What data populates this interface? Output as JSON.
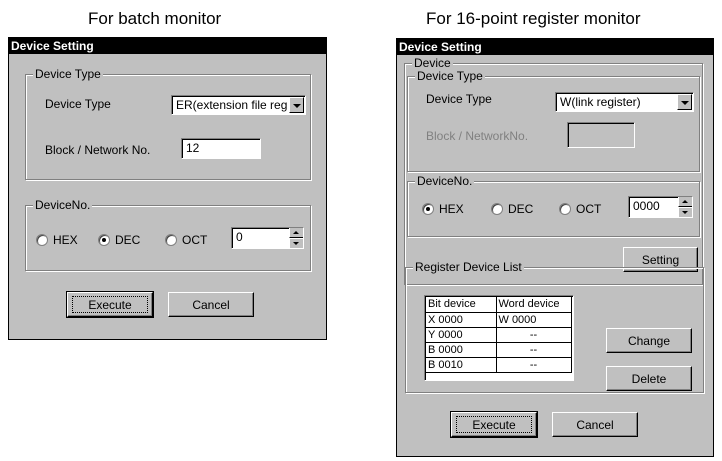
{
  "captions": {
    "batch": "For batch monitor",
    "register": "For 16-point register monitor"
  },
  "batch_dialog": {
    "title": "Device Setting",
    "device_type_group": "Device Type",
    "device_type_label": "Device Type",
    "device_type_value": "ER(extension file regi",
    "block_label": "Block / Network No.",
    "block_value": "12",
    "device_no_group": "DeviceNo.",
    "radio_hex": "HEX",
    "radio_dec": "DEC",
    "radio_oct": "OCT",
    "selected_radix": "DEC",
    "device_no_value": "0",
    "execute_label": "Execute",
    "cancel_label": "Cancel"
  },
  "register_dialog": {
    "title": "Device Setting",
    "device_group": "Device",
    "device_type_group": "Device Type",
    "device_type_label": "Device Type",
    "device_type_value": "W(link register)",
    "block_label": "Block / NetworkNo.",
    "block_value": "",
    "device_no_group": "DeviceNo.",
    "radio_hex": "HEX",
    "radio_dec": "DEC",
    "radio_oct": "OCT",
    "selected_radix": "HEX",
    "device_no_value": "0000",
    "setting_label": "Setting",
    "register_list_group": "Register Device List",
    "list_headers": [
      "Bit device",
      "Word device"
    ],
    "list_rows": [
      [
        "X 0000",
        "W 0000"
      ],
      [
        "Y 0000",
        "--"
      ],
      [
        "B 0000",
        "--"
      ],
      [
        "B 0010",
        "--"
      ]
    ],
    "change_label": "Change",
    "delete_label": "Delete",
    "execute_label": "Execute",
    "cancel_label": "Cancel"
  }
}
